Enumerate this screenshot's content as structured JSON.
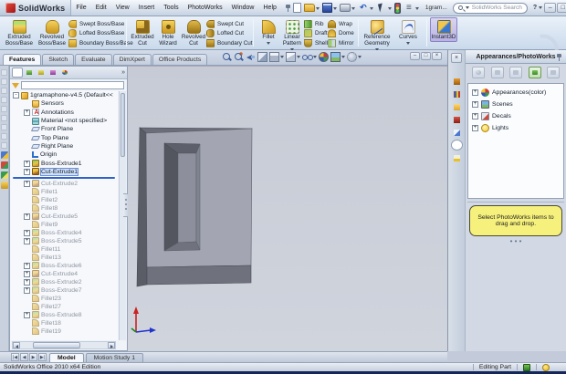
{
  "colors": {
    "brand_red": "#cc2229",
    "titlebar_top": "#f5f8fc",
    "titlebar_bottom": "#c6d2e2",
    "viewport_bg": "#cdd1da",
    "model_front": "#a3a6b2",
    "model_side": "#5a5c66",
    "model_band": "#6f727c",
    "rollback_blue": "#2f62c9",
    "note_yellow": "#f6f07c",
    "instant3d_pressed": "#c9c5ea"
  },
  "title_bar": {
    "app_name": "SolidWorks",
    "menus": [
      "File",
      "Edit",
      "View",
      "Insert",
      "Tools",
      "PhotoWorks",
      "Window",
      "Help"
    ],
    "toolbar": [
      {
        "name": "new-document-icon",
        "cls": "tb-new",
        "glyph": "",
        "extra": ""
      },
      {
        "name": "open-icon",
        "cls": "tb-open",
        "glyph": "",
        "extra": "has-caret"
      },
      {
        "name": "save-icon",
        "cls": "tb-save",
        "glyph": "",
        "extra": "has-caret"
      },
      {
        "name": "print-icon",
        "cls": "tb-print",
        "glyph": "",
        "extra": "has-caret"
      },
      {
        "name": "undo-icon",
        "cls": "tb-undo",
        "glyph": "↶",
        "extra": "has-caret"
      },
      {
        "name": "select-icon",
        "cls": "tb-select",
        "glyph": "",
        "extra": "has-caret"
      },
      {
        "name": "rebuild-icon",
        "cls": "tb-rebuild",
        "glyph": "",
        "extra": ""
      },
      {
        "name": "options-icon",
        "cls": "tb-options",
        "glyph": "≡",
        "extra": "has-caret"
      }
    ],
    "doc_name": "1gram...",
    "search_placeholder": "SolidWorks Search",
    "help_glyph": "?"
  },
  "icons": {
    "minimize": "–",
    "restore": "□",
    "close": "×",
    "chevron": "»",
    "dots": "• • •"
  },
  "command_manager": {
    "large1": [
      {
        "name": "extruded-boss-base-button",
        "label": "Extruded Boss/Base",
        "icon": "fi-extrboss",
        "extra": ""
      },
      {
        "name": "revolved-boss-base-button",
        "label": "Revolved Boss/Base",
        "icon": "fi-revboss",
        "extra": ""
      }
    ],
    "stack1": [
      {
        "name": "swept-boss-base-button",
        "label": "Swept Boss/Base",
        "icon": "fs-sweptboss"
      },
      {
        "name": "lofted-boss-base-button",
        "label": "Lofted Boss/Base",
        "icon": "fs-loftboss"
      },
      {
        "name": "boundary-boss-base-button",
        "label": "Boundary Boss/Base",
        "icon": "fs-boundboss"
      }
    ],
    "large2": [
      {
        "name": "extruded-cut-button",
        "label": "Extruded Cut",
        "icon": "fi-extrcut",
        "extra": ""
      },
      {
        "name": "hole-wizard-button",
        "label": "Hole Wizard",
        "icon": "fi-holewiz",
        "extra": ""
      },
      {
        "name": "revolved-cut-button",
        "label": "Revolved Cut",
        "icon": "fi-revcut",
        "extra": ""
      }
    ],
    "stack2": [
      {
        "name": "swept-cut-button",
        "label": "Swept Cut",
        "icon": "fs-sweptcut"
      },
      {
        "name": "lofted-cut-button",
        "label": "Lofted Cut",
        "icon": "fs-loftcut"
      },
      {
        "name": "boundary-cut-button",
        "label": "Boundary Cut",
        "icon": "fs-boundcut"
      }
    ],
    "large3": [
      {
        "name": "fillet-button",
        "label": "Fillet",
        "icon": "fi-fillet",
        "extra": "has-caret"
      },
      {
        "name": "linear-pattern-button",
        "label": "Linear Pattern",
        "icon": "fi-linpat",
        "extra": "has-caret"
      }
    ],
    "stack3": [
      {
        "name": "rib-button",
        "label": "Rib",
        "icon": "fs-rib"
      },
      {
        "name": "draft-button",
        "label": "Draft",
        "icon": "fs-draft"
      },
      {
        "name": "shell-button",
        "label": "Shell",
        "icon": "fs-shell"
      }
    ],
    "stack4": [
      {
        "name": "wrap-button",
        "label": "Wrap",
        "icon": "fs-wrap"
      },
      {
        "name": "dome-button",
        "label": "Dome",
        "icon": "fs-dome"
      },
      {
        "name": "mirror-button",
        "label": "Mirror",
        "icon": "fs-mirror"
      }
    ],
    "large4": [
      {
        "name": "reference-geometry-button",
        "label": "Reference Geometry",
        "icon": "fi-refgeom",
        "extra": "has-caret"
      },
      {
        "name": "curves-button",
        "label": "Curves",
        "icon": "fi-curves",
        "extra": "has-caret"
      }
    ],
    "large5": [
      {
        "name": "instant3d-button",
        "label": "Instant3D",
        "icon": "fi-inst3d",
        "extra": "pressed"
      }
    ]
  },
  "ribbon_tabs": [
    {
      "name": "tab-features",
      "label": "Features",
      "extra": "active"
    },
    {
      "name": "tab-sketch",
      "label": "Sketch",
      "extra": ""
    },
    {
      "name": "tab-evaluate",
      "label": "Evaluate",
      "extra": ""
    },
    {
      "name": "tab-dimxpert",
      "label": "DimXpert",
      "extra": ""
    },
    {
      "name": "tab-office-products",
      "label": "Office Products",
      "extra": ""
    }
  ],
  "hud": [
    {
      "name": "zoom-fit-icon",
      "cls": "hud-zoomfit",
      "extra": ""
    },
    {
      "name": "zoom-area-icon",
      "cls": "hud-zoomarea",
      "extra": ""
    },
    {
      "name": "previous-view-icon",
      "cls": "hud-prev",
      "extra": ""
    },
    {
      "name": "section-view-icon",
      "cls": "hud-section",
      "extra": ""
    },
    {
      "name": "view-orientation-icon",
      "cls": "hud-orient",
      "extra": "has-caret"
    },
    {
      "name": "display-style-icon",
      "cls": "hud-display",
      "extra": "has-caret"
    },
    {
      "name": "hide-show-items-icon",
      "cls": "hud-hide",
      "extra": "has-caret"
    },
    {
      "name": "edit-appearance-icon",
      "cls": "hud-appear",
      "extra": ""
    },
    {
      "name": "apply-scene-icon",
      "cls": "hud-scene",
      "extra": "has-caret"
    },
    {
      "name": "view-settings-icon",
      "cls": "hud-sett",
      "extra": "has-caret"
    }
  ],
  "left_strip": [
    {
      "name": "docked-toolbar-icon",
      "cls": "ls-pale"
    },
    {
      "name": "docked-toolbar-icon",
      "cls": "ls-pale"
    },
    {
      "name": "docked-toolbar-icon",
      "cls": "ls-pale"
    },
    {
      "name": "docked-toolbar-icon",
      "cls": "ls-pale"
    },
    {
      "name": "docked-toolbar-icon",
      "cls": "ls-pale"
    },
    {
      "name": "docked-toolbar-icon",
      "cls": "ls-pale"
    },
    {
      "name": "docked-toolbar-icon",
      "cls": "ls-pale"
    },
    {
      "name": "docked-toolbar-icon",
      "cls": "ls-pale"
    },
    {
      "name": "docked-toolbar-icon",
      "cls": "ls-pale"
    },
    {
      "name": "docked-toolbar-icon",
      "cls": "ls-blue"
    },
    {
      "name": "docked-toolbar-icon",
      "cls": "ls-red"
    },
    {
      "name": "docked-toolbar-icon",
      "cls": "ls-green"
    },
    {
      "name": "docked-toolbar-icon",
      "cls": "ls-gold"
    }
  ],
  "feature_manager": {
    "header_tabs": [
      {
        "name": "featuremanager-tree-tab",
        "cls": "fmh-tree",
        "extra": "active"
      },
      {
        "name": "propertymanager-tab",
        "cls": "fmh-prop",
        "extra": ""
      },
      {
        "name": "configurationmanager-tab",
        "cls": "fmh-config",
        "extra": ""
      },
      {
        "name": "dimxpertmanager-tab",
        "cls": "fmh-dimx",
        "extra": ""
      },
      {
        "name": "displaymanager-tab",
        "cls": "fmh-disp",
        "extra": ""
      }
    ],
    "items": [
      {
        "name": "tree-item-root",
        "label": "1gramaphone-v4.5 (Default<<",
        "icon": "ti-part",
        "exp": "-",
        "lvl": "lvl0",
        "state": ""
      },
      {
        "name": "tree-item-sensors",
        "label": "Sensors",
        "icon": "ti-sensors",
        "exp": "",
        "lvl": "lvl1",
        "state": ""
      },
      {
        "name": "tree-item-annotations",
        "label": "Annotations",
        "icon": "ti-annot",
        "exp": "+",
        "lvl": "lvl1",
        "state": ""
      },
      {
        "name": "tree-item-material",
        "label": "Material <not specified>",
        "icon": "ti-material",
        "exp": "",
        "lvl": "lvl1",
        "state": ""
      },
      {
        "name": "tree-item-front-plane",
        "label": "Front Plane",
        "icon": "ti-plane",
        "exp": "",
        "lvl": "lvl1",
        "state": ""
      },
      {
        "name": "tree-item-top-plane",
        "label": "Top Plane",
        "icon": "ti-plane",
        "exp": "",
        "lvl": "lvl1",
        "state": ""
      },
      {
        "name": "tree-item-right-plane",
        "label": "Right Plane",
        "icon": "ti-plane",
        "exp": "",
        "lvl": "lvl1",
        "state": ""
      },
      {
        "name": "tree-item-origin",
        "label": "Origin",
        "icon": "ti-origin",
        "exp": "",
        "lvl": "lvl1",
        "state": ""
      },
      {
        "name": "tree-item-boss-extrude1",
        "label": "Boss-Extrude1",
        "icon": "ti-boss",
        "exp": "+",
        "lvl": "lvl1",
        "state": ""
      },
      {
        "name": "tree-item-cut-extrude1",
        "label": "Cut-Extrude1",
        "icon": "ti-cut",
        "exp": "+",
        "lvl": "lvl1",
        "state": "selected"
      }
    ],
    "items_after_rollback": [
      {
        "name": "tree-item-cut-extrude2",
        "label": "Cut-Extrude2",
        "icon": "ti-cut",
        "exp": "+",
        "lvl": "lvl1",
        "state": "grayed"
      },
      {
        "name": "tree-item-fillet1",
        "label": "Fillet1",
        "icon": "ti-fillet",
        "exp": "",
        "lvl": "lvl1",
        "state": "grayed"
      },
      {
        "name": "tree-item-fillet2",
        "label": "Fillet2",
        "icon": "ti-fillet",
        "exp": "",
        "lvl": "lvl1",
        "state": "grayed"
      },
      {
        "name": "tree-item-fillet8",
        "label": "Fillet8",
        "icon": "ti-fillet",
        "exp": "",
        "lvl": "lvl1",
        "state": "grayed"
      },
      {
        "name": "tree-item-cut-extrude5",
        "label": "Cut-Extrude5",
        "icon": "ti-cut",
        "exp": "+",
        "lvl": "lvl1",
        "state": "grayed"
      },
      {
        "name": "tree-item-fillet9",
        "label": "Fillet9",
        "icon": "ti-fillet",
        "exp": "",
        "lvl": "lvl1",
        "state": "grayed"
      },
      {
        "name": "tree-item-boss-extrude4",
        "label": "Boss-Extrude4",
        "icon": "ti-boss",
        "exp": "+",
        "lvl": "lvl1",
        "state": "grayed"
      },
      {
        "name": "tree-item-boss-extrude5",
        "label": "Boss-Extrude5",
        "icon": "ti-boss",
        "exp": "+",
        "lvl": "lvl1",
        "state": "grayed"
      },
      {
        "name": "tree-item-fillet11",
        "label": "Fillet11",
        "icon": "ti-fillet",
        "exp": "",
        "lvl": "lvl1",
        "state": "grayed"
      },
      {
        "name": "tree-item-fillet13",
        "label": "Fillet13",
        "icon": "ti-fillet",
        "exp": "",
        "lvl": "lvl1",
        "state": "grayed"
      },
      {
        "name": "tree-item-boss-extrude6",
        "label": "Boss-Extrude6",
        "icon": "ti-boss",
        "exp": "+",
        "lvl": "lvl1",
        "state": "grayed"
      },
      {
        "name": "tree-item-cut-extrude4",
        "label": "Cut-Extrude4",
        "icon": "ti-cut",
        "exp": "+",
        "lvl": "lvl1",
        "state": "grayed"
      },
      {
        "name": "tree-item-boss-extrude2",
        "label": "Boss-Extrude2",
        "icon": "ti-boss",
        "exp": "+",
        "lvl": "lvl1",
        "state": "grayed"
      },
      {
        "name": "tree-item-boss-extrude7",
        "label": "Boss-Extrude7",
        "icon": "ti-boss",
        "exp": "+",
        "lvl": "lvl1",
        "state": "grayed"
      },
      {
        "name": "tree-item-fillet23",
        "label": "Fillet23",
        "icon": "ti-fillet",
        "exp": "",
        "lvl": "lvl1",
        "state": "grayed"
      },
      {
        "name": "tree-item-fillet27",
        "label": "Fillet27",
        "icon": "ti-fillet",
        "exp": "",
        "lvl": "lvl1",
        "state": "grayed"
      },
      {
        "name": "tree-item-boss-extrude8",
        "label": "Boss-Extrude8",
        "icon": "ti-boss",
        "exp": "+",
        "lvl": "lvl1",
        "state": "grayed"
      },
      {
        "name": "tree-item-fillet18",
        "label": "Fillet18",
        "icon": "ti-fillet",
        "exp": "",
        "lvl": "lvl1",
        "state": "grayed"
      },
      {
        "name": "tree-item-fillet19",
        "label": "Fillet19",
        "icon": "ti-fillet",
        "exp": "",
        "lvl": "lvl1",
        "state": "grayed"
      }
    ]
  },
  "task_pane": {
    "title": "Appearances/PhotoWorks",
    "rail": [
      {
        "name": "solidworks-resources-tab",
        "cls": "rl-home",
        "extra": ""
      },
      {
        "name": "design-library-tab",
        "cls": "rl-lib",
        "extra": ""
      },
      {
        "name": "file-explorer-tab",
        "cls": "rl-folder",
        "extra": ""
      },
      {
        "name": "solidworks-forum-tab",
        "cls": "rl-forum",
        "extra": ""
      },
      {
        "name": "view-palette-tab",
        "cls": "rl-palette",
        "extra": ""
      },
      {
        "name": "appearances-photoworks-tab",
        "cls": "rl-ball",
        "extra": "active"
      },
      {
        "name": "custom-properties-tab",
        "cls": "rl-props",
        "extra": ""
      }
    ],
    "tools": [
      {
        "name": "taskpane-tool-appearance",
        "cls": "tpt-ball"
      },
      {
        "name": "taskpane-tool-save",
        "cls": "tpt-save"
      },
      {
        "name": "taskpane-tool-copy",
        "cls": "tpt-copy"
      },
      {
        "name": "taskpane-tool-apply",
        "cls": "tpt-green"
      },
      {
        "name": "taskpane-tool-options",
        "cls": "tpt-opt"
      }
    ],
    "tree": [
      {
        "name": "taskpane-item-appearances",
        "label": "Appearances(color)",
        "icon": "tp-ball",
        "exp": "+"
      },
      {
        "name": "taskpane-item-scenes",
        "label": "Scenes",
        "icon": "tp-scene",
        "exp": "+"
      },
      {
        "name": "taskpane-item-decals",
        "label": "Decals",
        "icon": "tp-decal",
        "exp": "+"
      },
      {
        "name": "taskpane-item-lights",
        "label": "Lights",
        "icon": "tp-light",
        "exp": "+"
      }
    ],
    "note": "Select PhotoWorks items to drag and drop."
  },
  "bottom_nav": [
    {
      "name": "sheet-scroll-first-button",
      "glyph": "|◀"
    },
    {
      "name": "sheet-scroll-prev-button",
      "glyph": "◀"
    },
    {
      "name": "sheet-scroll-next-button",
      "glyph": "▶"
    },
    {
      "name": "sheet-scroll-last-button",
      "glyph": "▶|"
    }
  ],
  "bottom_tabs": [
    {
      "name": "model-tab",
      "label": "Model",
      "extra": "active"
    },
    {
      "name": "motion-study-tab",
      "label": "Motion Study 1",
      "extra": ""
    }
  ],
  "status_bar": {
    "app_edition": "SolidWorks Office 2010 x64 Edition",
    "mode": "Editing Part"
  }
}
